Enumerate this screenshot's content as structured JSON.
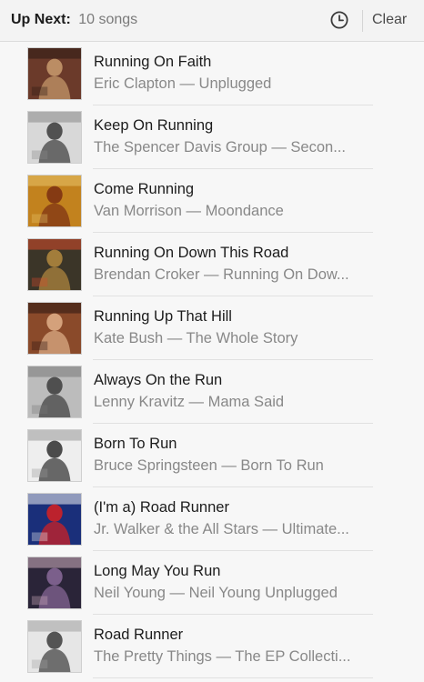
{
  "header": {
    "label": "Up Next:",
    "count": "10 songs",
    "clear_label": "Clear",
    "history_icon": "clock-icon"
  },
  "songs": [
    {
      "title": "Running On Faith",
      "subtitle": "Eric Clapton — Unplugged",
      "art": {
        "bg": "#6b3a2a",
        "fg": "#c99c6e",
        "accent": "#2a1a12"
      }
    },
    {
      "title": "Keep On Running",
      "subtitle": "The Spencer Davis Group — Secon...",
      "art": {
        "bg": "#d8d8d8",
        "fg": "#3a3a3a",
        "accent": "#8a8a8a"
      }
    },
    {
      "title": "Come Running",
      "subtitle": "Van Morrison — Moondance",
      "art": {
        "bg": "#c2821e",
        "fg": "#7a2e12",
        "accent": "#e9c56a"
      }
    },
    {
      "title": "Running On Down This Road",
      "subtitle": "Brendan Croker — Running On Dow...",
      "art": {
        "bg": "#3b3528",
        "fg": "#b58a3e",
        "accent": "#d94a2a"
      }
    },
    {
      "title": "Running Up That Hill",
      "subtitle": "Kate Bush — The Whole Story",
      "art": {
        "bg": "#8a4a2a",
        "fg": "#e0b08a",
        "accent": "#2a1510"
      }
    },
    {
      "title": "Always On the Run",
      "subtitle": "Lenny Kravitz — Mama Said",
      "art": {
        "bg": "#bcbcbc",
        "fg": "#3c3c3c",
        "accent": "#787878"
      }
    },
    {
      "title": "Born To Run",
      "subtitle": "Bruce Springsteen — Born To Run",
      "art": {
        "bg": "#eeeeee",
        "fg": "#2e2e2e",
        "accent": "#999999"
      }
    },
    {
      "title": "(I'm a) Road Runner",
      "subtitle": "Jr. Walker & the All Stars — Ultimate...",
      "art": {
        "bg": "#1a2f7a",
        "fg": "#d92020",
        "accent": "#f2f2f2"
      }
    },
    {
      "title": "Long May You Run",
      "subtitle": "Neil Young — Neil Young Unplugged",
      "art": {
        "bg": "#2a2438",
        "fg": "#8a6a9a",
        "accent": "#d0b0c0"
      }
    },
    {
      "title": "Road Runner",
      "subtitle": "The Pretty Things — The EP Collecti...",
      "art": {
        "bg": "#e6e6e6",
        "fg": "#3a3a3a",
        "accent": "#a0a0a0"
      }
    }
  ]
}
